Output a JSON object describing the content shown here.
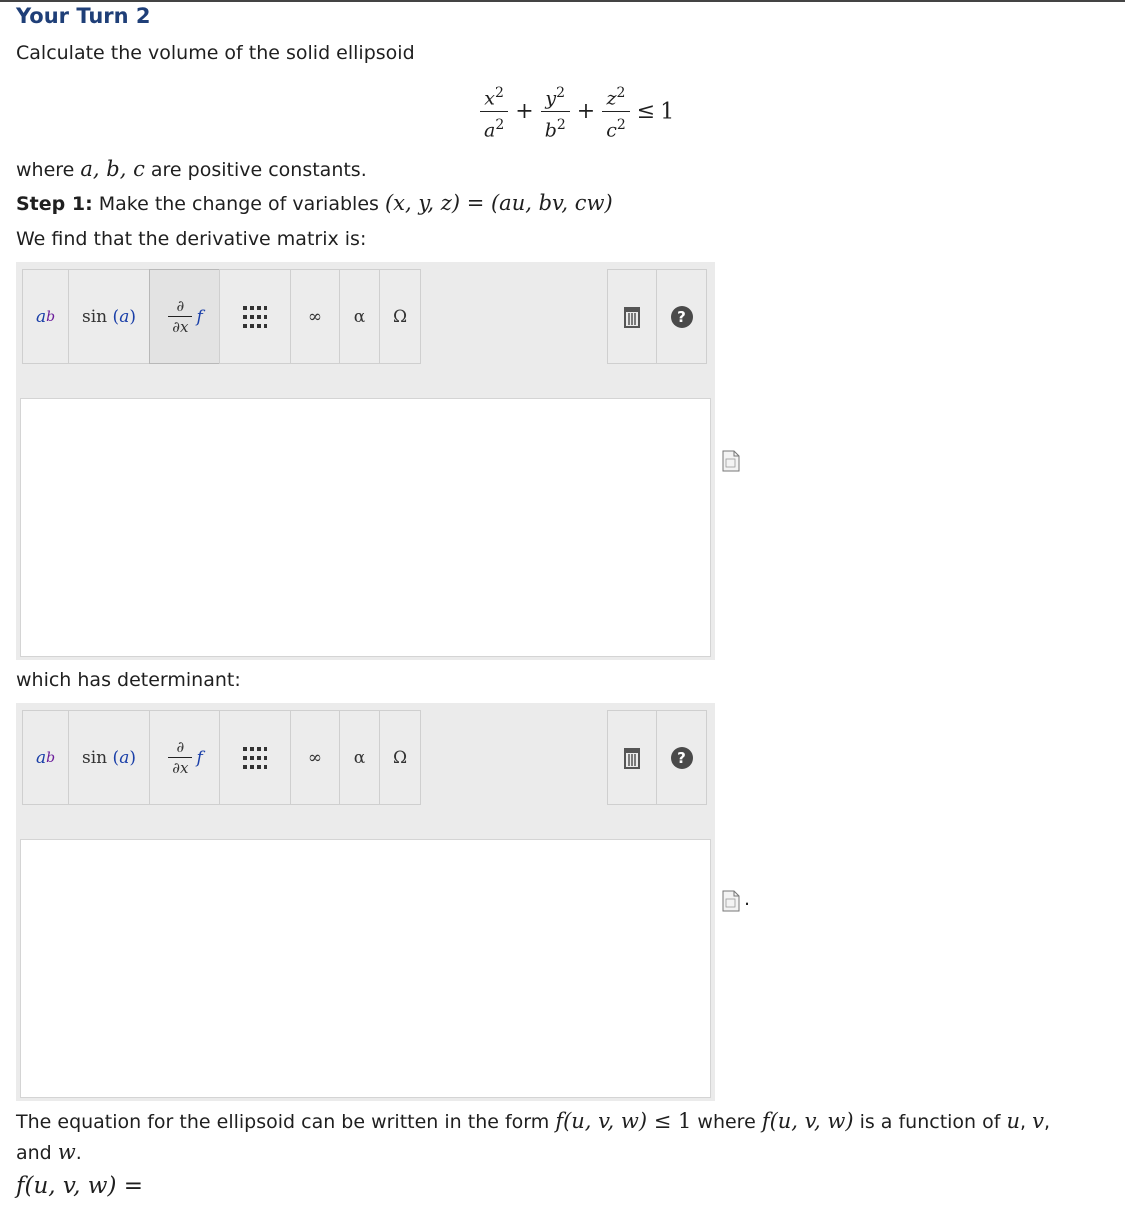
{
  "title": "Your Turn 2",
  "intro": "Calculate the volume of the solid ellipsoid",
  "inequality": {
    "terms": [
      {
        "num": "x",
        "num_exp": "2",
        "den": "a",
        "den_exp": "2"
      },
      {
        "num": "y",
        "num_exp": "2",
        "den": "b",
        "den_exp": "2"
      },
      {
        "num": "z",
        "num_exp": "2",
        "den": "c",
        "den_exp": "2"
      }
    ],
    "plus": "+",
    "relation": "≤",
    "rhs": "1"
  },
  "where_line": {
    "prefix": "where ",
    "vars": "a, b, c",
    "suffix": " are positive constants."
  },
  "step1": {
    "label": "Step 1:",
    "text": " Make the change of variables ",
    "lhs": "(x, y, z)",
    "eq": " = ",
    "rhs": "(au, bv, cw)"
  },
  "derivative_text": "We find that the derivative matrix is:",
  "determinant_text": "which has determinant:",
  "toolbar": {
    "power_base": "a",
    "power_exp": "b",
    "sin_label": "sin",
    "sin_arg": "(a)",
    "partial_num": "∂",
    "partial_den": "∂x",
    "partial_f": "f",
    "infinity": "∞",
    "alpha": "α",
    "omega": "Ω",
    "help": "?"
  },
  "equation_line": {
    "t1": "The equation for the ellipsoid can be written in the form ",
    "f1": "f(u, v, w)",
    "rel": " ≤ ",
    "one": "1",
    "t2": " where ",
    "f2": "f(u, v, w)",
    "t3": " is a function of ",
    "u": "u",
    "c1": ", ",
    "v": "v",
    "c2": ","
  },
  "and_line": {
    "t": "and ",
    "w": "w",
    "dot": "."
  },
  "final": {
    "lhs": "f(u, v, w)",
    "eq": " ="
  },
  "trailing_dot": ".",
  "colors": {
    "title": "#1f3f78",
    "toolbar_bg": "#ebebeb",
    "power_base": "#1a3fa8",
    "power_exp": "#6a1b9a",
    "partial_f": "#1a3fa8"
  }
}
